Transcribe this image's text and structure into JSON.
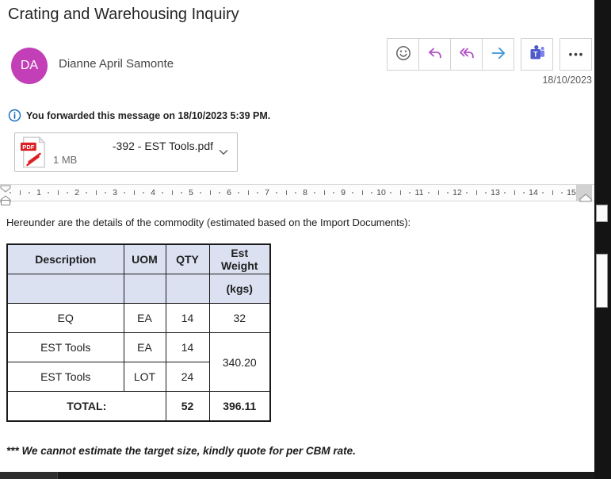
{
  "colors": {
    "avatar-bg": "#c33fb7",
    "reply-purple": "#b04fc4",
    "forward-blue": "#3a95da",
    "info-blue": "#0f6cbd",
    "pdf-red": "#dd2025",
    "teams-purple": "#5059c9",
    "teams-light": "#7b83eb",
    "table-header-bg": "#dce1f2",
    "table-border": "#1a1a1a"
  },
  "header": {
    "subject": "Crating and Warehousing Inquiry",
    "sender_name": "Dianne April Samonte",
    "avatar_initials": "DA",
    "date": "18/10/2023",
    "toolbar": {
      "more_label": "•••",
      "teams_letter": "T"
    }
  },
  "icons": {
    "reaction": "smiley-face-icon",
    "reply": "reply-arrow-icon",
    "reply_all": "reply-all-arrow-icon",
    "forward": "forward-arrow-icon",
    "teams": "share-to-teams-icon",
    "more": "ellipsis-icon",
    "info": "info-circle-icon",
    "attachment_type": "pdf-file-icon",
    "attachment_expand": "chevron-down-icon"
  },
  "notice": {
    "text": "You forwarded this message on 18/10/2023 5:39 PM."
  },
  "attachment": {
    "filename": "-392 - EST Tools.pdf",
    "size": "1 MB",
    "type_label": "PDF"
  },
  "ruler": {
    "numbers": [
      1,
      2,
      3,
      4,
      5,
      6,
      7,
      8,
      9,
      10,
      11,
      12,
      13,
      14,
      15
    ]
  },
  "body": {
    "intro": "Hereunder are the details of the commodity (estimated based on the Import Documents):",
    "note": "*** We cannot estimate the target size, kindly quote for per CBM rate."
  },
  "table": {
    "headers": [
      "Description",
      "UOM",
      "QTY",
      "Est Weight"
    ],
    "subheader_kgs": "(kgs)",
    "rows": [
      {
        "description": "EQ",
        "uom": "EA",
        "qty": "14",
        "weight": "32"
      },
      {
        "description": "EST Tools",
        "uom": "EA",
        "qty": "14",
        "weight_merged": "340.20"
      },
      {
        "description": "EST Tools",
        "uom": "LOT",
        "qty": "24"
      }
    ],
    "total": {
      "label": "TOTAL:",
      "qty": "52",
      "weight": "396.11"
    }
  }
}
